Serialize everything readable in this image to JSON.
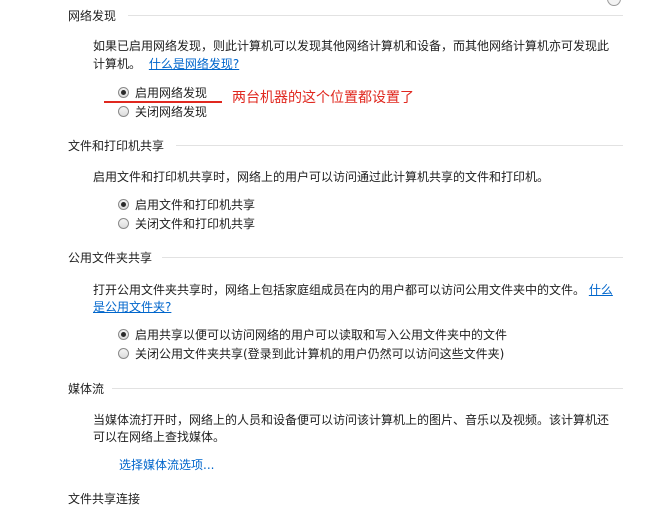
{
  "network_discovery": {
    "title": "网络发现",
    "description_line1": "如果已启用网络发现，则此计算机可以发现其他网络计算机和设备，而其他网络计算机亦可发现此",
    "description_line2": "计算机。",
    "help_link": "什么是网络发现?",
    "options": [
      {
        "label": "启用网络发现",
        "checked": true
      },
      {
        "label": "关闭网络发现",
        "checked": false
      }
    ],
    "annotation": "两台机器的这个位置都设置了",
    "annotation_color": "#e0281f"
  },
  "file_printer_sharing": {
    "title": "文件和打印机共享",
    "description": "启用文件和打印机共享时，网络上的用户可以访问通过此计算机共享的文件和打印机。",
    "options": [
      {
        "label": "启用文件和打印机共享",
        "checked": true
      },
      {
        "label": "关闭文件和打印机共享",
        "checked": false
      }
    ]
  },
  "public_folder_sharing": {
    "title": "公用文件夹共享",
    "description_line1": "打开公用文件夹共享时，网络上包括家庭组成员在内的用户都可以访问公用文件夹中的文件。",
    "help_link_part1": "什么",
    "help_link_part2": "是公用文件夹?",
    "options": [
      {
        "label": "启用共享以便可以访问网络的用户可以读取和写入公用文件夹中的文件",
        "checked": true
      },
      {
        "label": "关闭公用文件夹共享(登录到此计算机的用户仍然可以访问这些文件夹)",
        "checked": false
      }
    ]
  },
  "media_streaming": {
    "title": "媒体流",
    "description_line1": "当媒体流打开时，网络上的人员和设备便可以访问该计算机上的图片、音乐以及视频。该计算机还",
    "description_line2": "可以在网络上查找媒体。",
    "link": "选择媒体流选项..."
  },
  "next_section": {
    "title": "文件共享连接"
  },
  "colors": {
    "link": "#0066cc",
    "annotation": "#e0281f",
    "text": "#1e1e1e",
    "divider": "#e2e2e2"
  }
}
